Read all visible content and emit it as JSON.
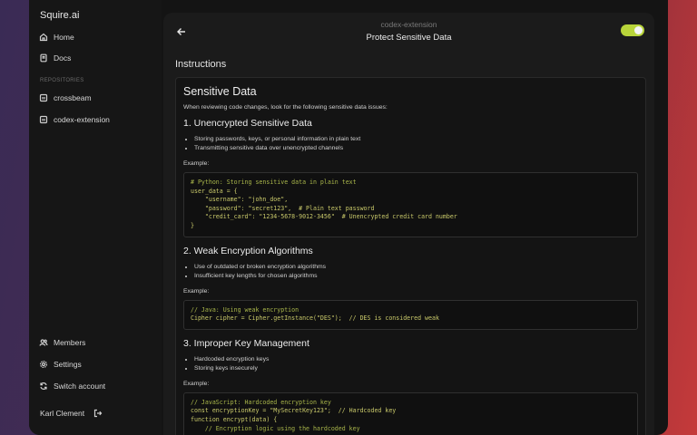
{
  "app": {
    "brand": "Squire.ai"
  },
  "sidebar": {
    "nav": [
      {
        "label": "Home",
        "icon": "home-icon"
      },
      {
        "label": "Docs",
        "icon": "docs-icon"
      }
    ],
    "repositories_label": "REPOSITORIES",
    "repositories": [
      {
        "label": "crossbeam",
        "icon": "repo-icon"
      },
      {
        "label": "codex-extension",
        "icon": "repo-icon"
      }
    ],
    "bottom": [
      {
        "label": "Members",
        "icon": "members-icon"
      },
      {
        "label": "Settings",
        "icon": "gear-icon"
      },
      {
        "label": "Switch account",
        "icon": "switch-icon"
      }
    ],
    "user": {
      "name": "Karl Clement",
      "icon": "logout-icon"
    }
  },
  "header": {
    "breadcrumb": "codex-extension",
    "title": "Protect Sensitive Data",
    "toggle_on": true,
    "toggle_color": "#b8d43a"
  },
  "main": {
    "instructions_label": "Instructions",
    "doc": {
      "title": "Sensitive Data",
      "intro": "When reviewing code changes, look for the following sensitive data issues:",
      "sections": [
        {
          "heading": "1. Unencrypted Sensitive Data",
          "bullets": [
            "Storing passwords, keys, or personal information in plain text",
            "Transmitting sensitive data over unencrypted channels"
          ],
          "example_label": "Example:",
          "code": [
            "# Python: Storing sensitive data in plain text",
            "user_data = {",
            "    \"username\": \"john_doe\",",
            "    \"password\": \"secret123\",  # Plain text password",
            "    \"credit_card\": \"1234-5678-9012-3456\"  # Unencrypted credit card number",
            "}"
          ]
        },
        {
          "heading": "2. Weak Encryption Algorithms",
          "bullets": [
            "Use of outdated or broken encryption algorithms",
            "Insufficient key lengths for chosen algorithms"
          ],
          "example_label": "Example:",
          "code": [
            "// Java: Using weak encryption",
            "Cipher cipher = Cipher.getInstance(\"DES\");  // DES is considered weak"
          ]
        },
        {
          "heading": "3. Improper Key Management",
          "bullets": [
            "Hardcoded encryption keys",
            "Storing keys insecurely"
          ],
          "example_label": "Example:",
          "code": [
            "// JavaScript: Hardcoded encryption key",
            "const encryptionKey = \"MySecretKey123\";  // Hardcoded key",
            "function encrypt(data) {",
            "    // Encryption logic using the hardcoded key"
          ]
        }
      ]
    }
  }
}
